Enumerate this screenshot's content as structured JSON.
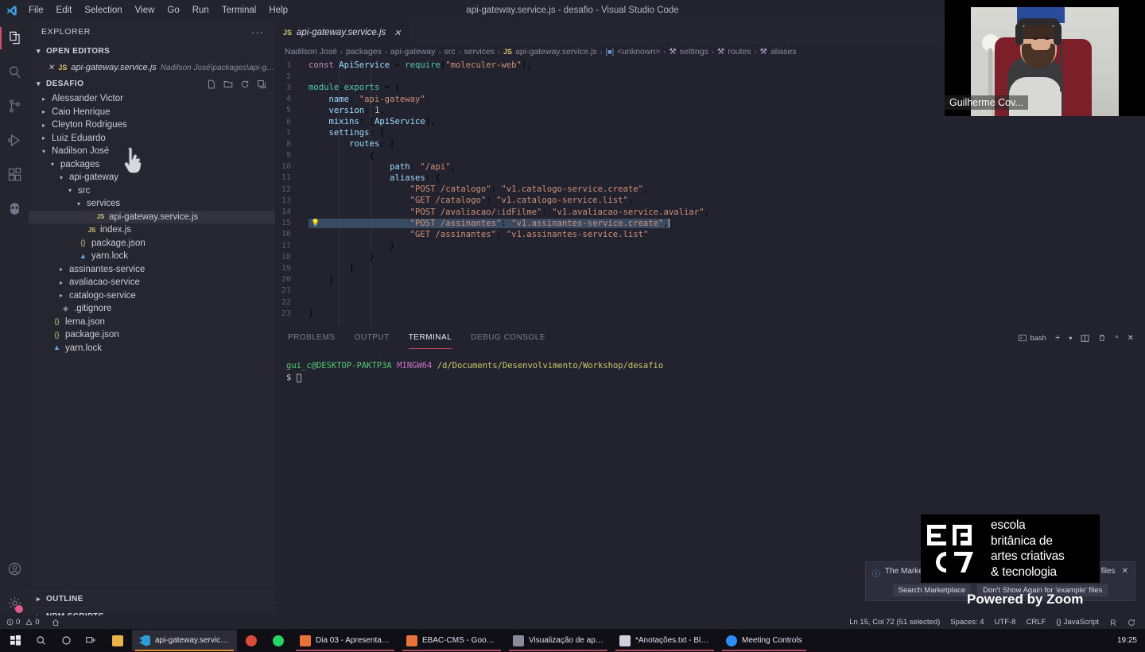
{
  "window": {
    "title": "api-gateway.service.js - desafio - Visual Studio Code"
  },
  "menubar": {
    "items": [
      "File",
      "Edit",
      "Selection",
      "View",
      "Go",
      "Run",
      "Terminal",
      "Help"
    ]
  },
  "activitybar": {
    "items": [
      {
        "name": "explorer-icon",
        "label": "Explorer",
        "active": true
      },
      {
        "name": "search-icon",
        "label": "Search",
        "active": false
      },
      {
        "name": "source-control-icon",
        "label": "Source Control",
        "active": false
      },
      {
        "name": "run-debug-icon",
        "label": "Run and Debug",
        "active": false
      },
      {
        "name": "extensions-icon",
        "label": "Extensions",
        "active": false
      },
      {
        "name": "owl-extension-icon",
        "label": "Extension",
        "active": false
      }
    ],
    "bottom": [
      {
        "name": "account-icon",
        "label": "Accounts"
      },
      {
        "name": "settings-gear-icon",
        "label": "Manage"
      }
    ]
  },
  "sidebar": {
    "header": "EXPLORER",
    "dots": "···",
    "open_editors": {
      "title": "OPEN EDITORS",
      "items": [
        {
          "name": "api-gateway.service.js",
          "path": "Nadilson José\\packages\\api-gateway\\src\\...",
          "badge": "JS"
        }
      ]
    },
    "workspace": {
      "title": "DESAFIO",
      "tree": [
        {
          "label": "Alessander Victor",
          "depth": 1,
          "type": "folder",
          "expanded": false
        },
        {
          "label": "Caio Henrique",
          "depth": 1,
          "type": "folder",
          "expanded": false
        },
        {
          "label": "Cleyton Rodrigues",
          "depth": 1,
          "type": "folder",
          "expanded": false
        },
        {
          "label": "Luiz Eduardo",
          "depth": 1,
          "type": "folder",
          "expanded": false
        },
        {
          "label": "Nadilson José",
          "depth": 1,
          "type": "folder",
          "expanded": true
        },
        {
          "label": "packages",
          "depth": 2,
          "type": "folder",
          "expanded": true
        },
        {
          "label": "api-gateway",
          "depth": 3,
          "type": "folder",
          "expanded": true
        },
        {
          "label": "src",
          "depth": 4,
          "type": "folder",
          "expanded": true
        },
        {
          "label": "services",
          "depth": 5,
          "type": "folder",
          "expanded": true
        },
        {
          "label": "api-gateway.service.js",
          "depth": 6,
          "type": "js",
          "selected": true
        },
        {
          "label": "index.js",
          "depth": 5,
          "type": "js"
        },
        {
          "label": "package.json",
          "depth": 4,
          "type": "json"
        },
        {
          "label": "yarn.lock",
          "depth": 4,
          "type": "yarn"
        },
        {
          "label": "assinantes-service",
          "depth": 3,
          "type": "folder",
          "expanded": false
        },
        {
          "label": "avaliacao-service",
          "depth": 3,
          "type": "folder",
          "expanded": false
        },
        {
          "label": "catalogo-service",
          "depth": 3,
          "type": "folder",
          "expanded": false
        },
        {
          "label": ".gitignore",
          "depth": 2,
          "type": "git"
        },
        {
          "label": "lerna.json",
          "depth": 1,
          "type": "json"
        },
        {
          "label": "package.json",
          "depth": 1,
          "type": "json"
        },
        {
          "label": "yarn.lock",
          "depth": 1,
          "type": "yarn"
        }
      ]
    },
    "bottom_sections": [
      "OUTLINE",
      "NPM SCRIPTS"
    ]
  },
  "editor": {
    "tab": {
      "label": "api-gateway.service.js",
      "badge": "JS",
      "close": "✕"
    },
    "breadcrumb": [
      "Nadilson José",
      "packages",
      "api-gateway",
      "src",
      "services",
      "api-gateway.service.js",
      "<unknown>",
      "settings",
      "routes",
      "aliases"
    ],
    "lines": [
      {
        "n": 1,
        "code": "const ApiService = require(\"moleculer-web\");"
      },
      {
        "n": 2,
        "code": ""
      },
      {
        "n": 3,
        "code": "module.exports = {"
      },
      {
        "n": 4,
        "code": "    name: \"api-gateway\","
      },
      {
        "n": 5,
        "code": "    version: 1,"
      },
      {
        "n": 6,
        "code": "    mixins: [ApiService],"
      },
      {
        "n": 7,
        "code": "    settings: {"
      },
      {
        "n": 8,
        "code": "        routes: ["
      },
      {
        "n": 9,
        "code": "            {"
      },
      {
        "n": 10,
        "code": "                path: \"/api\","
      },
      {
        "n": 11,
        "code": "                aliases: {"
      },
      {
        "n": 12,
        "code": "                    \"POST /catalogo\": \"v1.catalogo-service.create\","
      },
      {
        "n": 13,
        "code": "                    \"GET /catalogo\": \"v1.catalogo-service.list\","
      },
      {
        "n": 14,
        "code": "                    \"POST /avaliacao/:idFilme\": \"v1.avaliacao-service.avaliar\","
      },
      {
        "n": 15,
        "code": "                    \"POST /assinantes\": \"v1.assinantes-service.create\",",
        "bulb": true,
        "selected": true
      },
      {
        "n": 16,
        "code": "                    \"GET /assinantes\": \"v1.assinantes-service.list\""
      },
      {
        "n": 17,
        "code": "                }"
      },
      {
        "n": 18,
        "code": "            }"
      },
      {
        "n": 19,
        "code": "        ]"
      },
      {
        "n": 20,
        "code": "    }"
      },
      {
        "n": 21,
        "code": ""
      },
      {
        "n": 22,
        "code": ""
      },
      {
        "n": 23,
        "code": "}"
      }
    ]
  },
  "panel": {
    "tabs": [
      {
        "label": "PROBLEMS",
        "active": false
      },
      {
        "label": "OUTPUT",
        "active": false
      },
      {
        "label": "TERMINAL",
        "active": true
      },
      {
        "label": "DEBUG CONSOLE",
        "active": false
      }
    ],
    "shell": "bash",
    "actions": [
      "new-terminal-icon",
      "chevron-down-icon",
      "split-terminal-icon",
      "trash-icon",
      "chevron-up-icon",
      "close-icon"
    ],
    "terminal": {
      "user": "gui_c@DESKTOP-PAKTP3A",
      "shell_tag": "MINGW64",
      "cwd": "/d/Documents/Desenvolvimento/Workshop/desafio",
      "prompt": "$"
    }
  },
  "toast": {
    "icon": "info-icon",
    "message": "The Marketplace has extensions that can help with 'example' files",
    "buttons": [
      "Search Marketplace",
      "Don't Show Again for 'example' files"
    ],
    "close": "✕"
  },
  "overlay": {
    "brand_lines": [
      "escola",
      "britânica de",
      "artes criativas",
      "& tecnologia"
    ],
    "powered_by": "Powered by Zoom"
  },
  "webcam": {
    "participant": "Guilherme Cov..."
  },
  "statusbar": {
    "left": [
      {
        "name": "remote-indicator",
        "label": ""
      },
      {
        "name": "error-count",
        "label": "0"
      },
      {
        "name": "warning-count",
        "label": "0"
      },
      {
        "name": "ports-icon",
        "label": ""
      }
    ],
    "errors": "0",
    "warnings": "0",
    "right": [
      {
        "name": "cursor-position",
        "label": "Ln 15, Col 72 (51 selected)"
      },
      {
        "name": "indentation",
        "label": "Spaces: 4"
      },
      {
        "name": "encoding",
        "label": "UTF-8"
      },
      {
        "name": "eol",
        "label": "CRLF"
      },
      {
        "name": "language-mode",
        "label": "JavaScript"
      },
      {
        "name": "prettier-icon",
        "label": ""
      },
      {
        "name": "sync-icon",
        "label": ""
      }
    ]
  },
  "taskbar": {
    "system": [
      "start-icon",
      "search-icon",
      "cortana-icon",
      "task-view-icon"
    ],
    "apps": [
      {
        "label": "",
        "icon": "file-explorer-icon",
        "color": "#e8b44a",
        "active": false,
        "underline": ""
      },
      {
        "label": "api-gateway.service.js-...",
        "icon": "vscode-icon",
        "color": "#2d9cd6",
        "active": true,
        "underline": "#d88a2a"
      },
      {
        "label": "",
        "icon": "chrome-icon",
        "color": "#d94b3a",
        "active": false,
        "underline": ""
      },
      {
        "label": "",
        "icon": "whatsapp-icon",
        "color": "#25d366",
        "active": false,
        "underline": ""
      },
      {
        "label": "Dia 03 - Apresentaçõe...",
        "icon": "slides-icon",
        "color": "#e8733a",
        "active": false,
        "underline": "#a84a5a"
      },
      {
        "label": "EBAC-CMS - Google ...",
        "icon": "slides-icon",
        "color": "#e8733a",
        "active": false,
        "underline": "#a84a5a"
      },
      {
        "label": "Visualização de apres...",
        "icon": "slides-view-icon",
        "color": "#8a8a9a",
        "active": false,
        "underline": "#a84a5a"
      },
      {
        "label": "*Anotações.txt - Bloc...",
        "icon": "notepad-icon",
        "color": "#cfcfe0",
        "active": false,
        "underline": "#a84a5a"
      },
      {
        "label": "Meeting Controls",
        "icon": "zoom-icon",
        "color": "#2d8cff",
        "active": false,
        "underline": "#a84a5a"
      }
    ],
    "clock": "19:25"
  }
}
